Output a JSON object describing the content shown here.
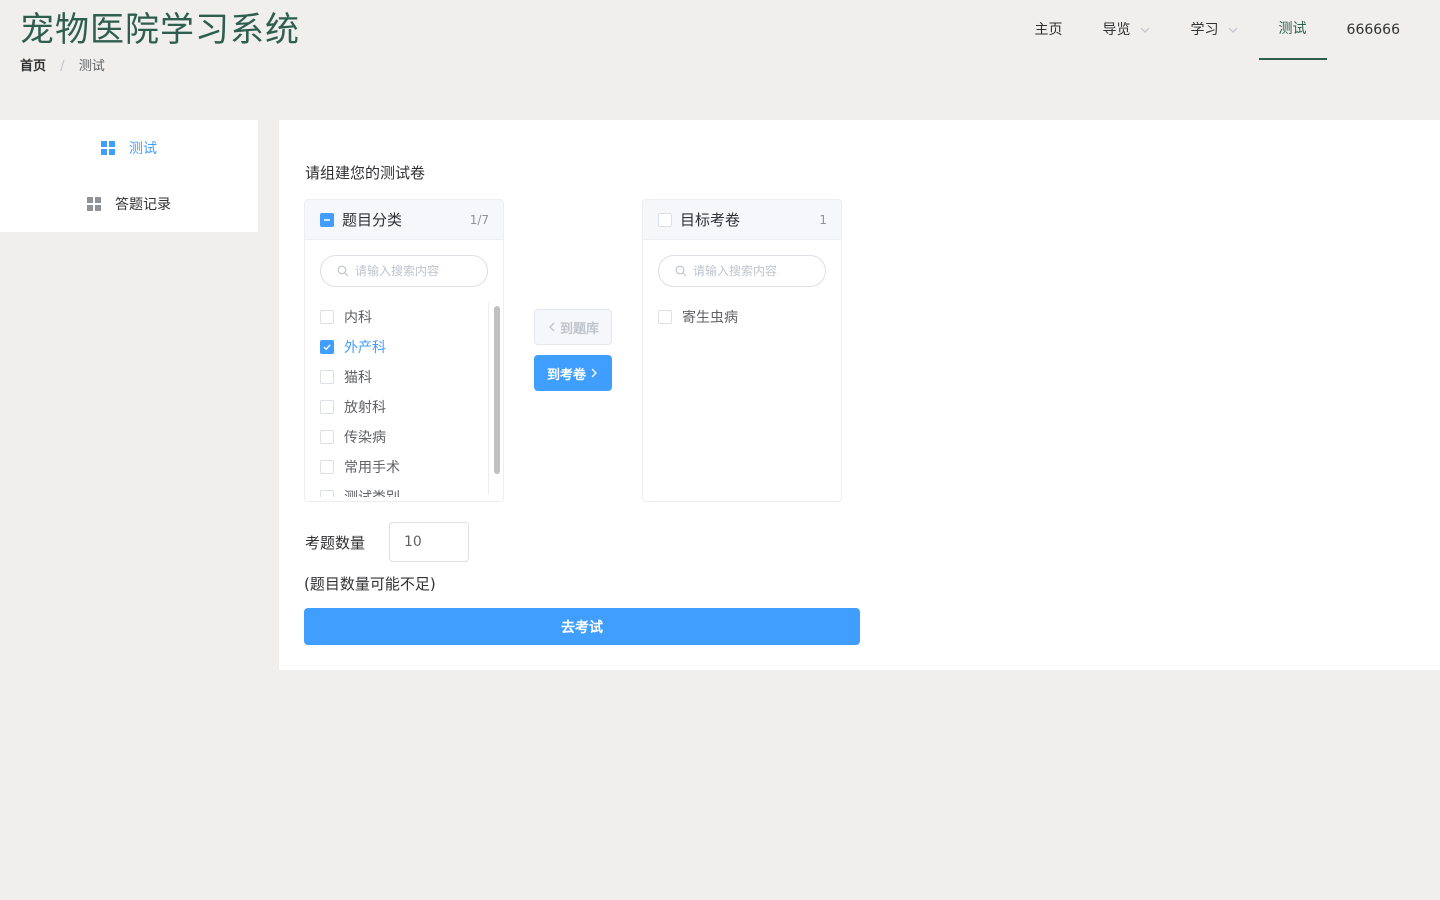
{
  "header": {
    "app_title": "宠物医院学习系统",
    "breadcrumb": {
      "home": "首页",
      "separator": "/",
      "current": "测试"
    }
  },
  "nav": {
    "items": [
      {
        "label": "主页",
        "dropdown": false,
        "active": false
      },
      {
        "label": "导览",
        "dropdown": true,
        "active": false
      },
      {
        "label": "学习",
        "dropdown": true,
        "active": false
      },
      {
        "label": "测试",
        "dropdown": false,
        "active": true
      },
      {
        "label": "666666",
        "dropdown": false,
        "active": false
      }
    ]
  },
  "sidebar": {
    "items": [
      {
        "label": "测试",
        "icon": "grid-icon",
        "active": true
      },
      {
        "label": "答题记录",
        "icon": "grid-icon",
        "active": false
      }
    ]
  },
  "main": {
    "title": "请组建您的测试卷",
    "transfer": {
      "left": {
        "title": "题目分类",
        "count": "1/7",
        "search_placeholder": "请输入搜索内容",
        "items": [
          {
            "label": "内科",
            "checked": false
          },
          {
            "label": "外产科",
            "checked": true
          },
          {
            "label": "猫科",
            "checked": false
          },
          {
            "label": "放射科",
            "checked": false
          },
          {
            "label": "传染病",
            "checked": false
          },
          {
            "label": "常用手术",
            "checked": false
          },
          {
            "label": "测试类别",
            "checked": false
          }
        ]
      },
      "right": {
        "title": "目标考卷",
        "count": "1",
        "search_placeholder": "请输入搜索内容",
        "items": [
          {
            "label": "寄生虫病",
            "checked": false
          }
        ]
      },
      "to_left_button": "到题库",
      "to_right_button": "到考卷"
    },
    "question_count_label": "考题数量",
    "question_count_value": "10",
    "note": "(题目数量可能不足)",
    "submit_button": "去考试"
  },
  "colors": {
    "brand": "#2e5e50",
    "primary": "#409eff",
    "background": "#f0efed"
  }
}
